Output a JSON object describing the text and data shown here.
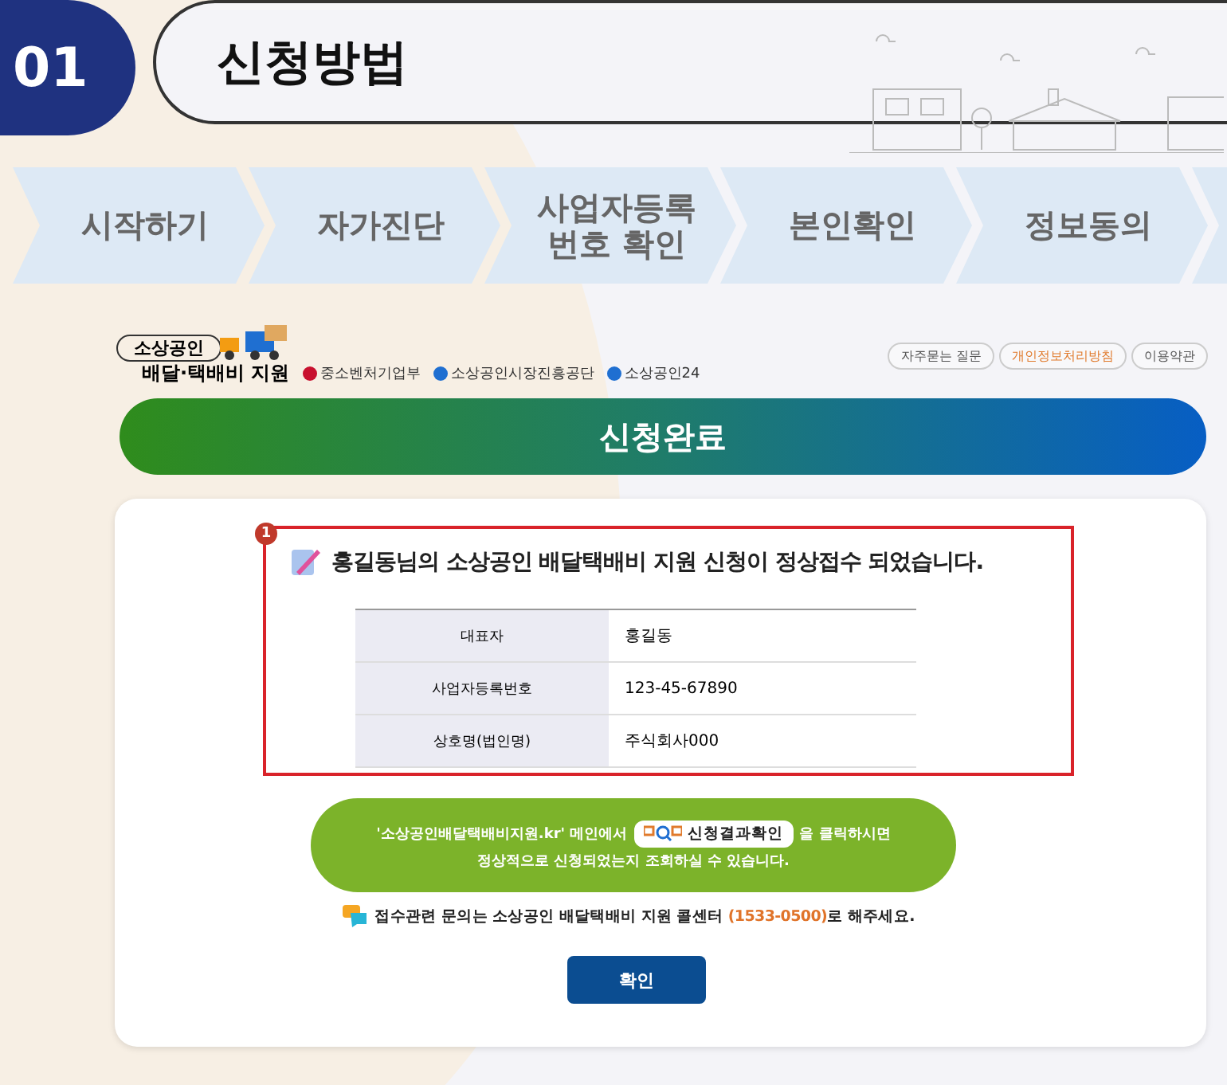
{
  "header": {
    "step_number": "01",
    "title": "신청방법"
  },
  "steps": [
    {
      "label": "시작하기"
    },
    {
      "label": "자가진단"
    },
    {
      "label": "사업자등록 번호 확인"
    },
    {
      "label": "본인확인"
    },
    {
      "label": "정보동의"
    }
  ],
  "site": {
    "logo_top": "소상공인",
    "logo_bottom": "배달·택배비 지원",
    "agencies": [
      "중소벤처기업부",
      "소상공인시장진흥공단",
      "소상공인24"
    ],
    "links": [
      {
        "label": "자주묻는 질문",
        "emphasized": false
      },
      {
        "label": "개인정보처리방침",
        "emphasized": true
      },
      {
        "label": "이용약관",
        "emphasized": false
      }
    ]
  },
  "banner": "신청완료",
  "result": {
    "marker": "1",
    "message": "홍길동님의 소상공인 배달택배비 지원 신청이 정상접수 되었습니다.",
    "rows": [
      {
        "label": "대표자",
        "value": "홍길동"
      },
      {
        "label": "사업자등록번호",
        "value": "123-45-67890"
      },
      {
        "label": "상호명(법인명)",
        "value": "주식회사000"
      }
    ]
  },
  "notice": {
    "before": "'소상공인배달택배비지원.kr' 메인에서",
    "chip": "신청결과확인",
    "after": "을 클릭하시면",
    "line2": "정상적으로 신청되었는지 조회하실 수 있습니다."
  },
  "contact": {
    "before": "접수관련 문의는 소상공인 배달택배비 지원 콜센터 ",
    "phone": "(1533-0500)",
    "after": "로 해주세요."
  },
  "confirm_button": "확인"
}
